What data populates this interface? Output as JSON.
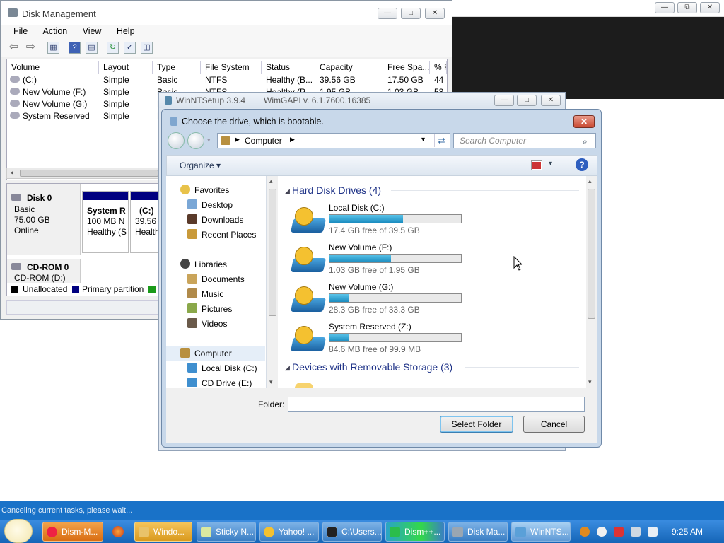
{
  "background_window": {
    "buttons": [
      "—",
      "⧉",
      "✕"
    ]
  },
  "disk_management": {
    "title": "Disk Management",
    "menu": [
      "File",
      "Action",
      "View",
      "Help"
    ],
    "columns": [
      "Volume",
      "Layout",
      "Type",
      "File System",
      "Status",
      "Capacity",
      "Free Spa...",
      "% F"
    ],
    "rows": [
      {
        "volume": "(C:)",
        "layout": "Simple",
        "type": "Basic",
        "fs": "NTFS",
        "status": "Healthy (B...",
        "capacity": "39.56 GB",
        "free": "17.50 GB",
        "pct": "44"
      },
      {
        "volume": "New Volume (F:)",
        "layout": "Simple",
        "type": "Basic",
        "fs": "NTFS",
        "status": "Healthy (P...",
        "capacity": "1.95 GB",
        "free": "1.03 GB",
        "pct": "53"
      },
      {
        "volume": "New Volume (G:)",
        "layout": "Simple",
        "type": "B",
        "fs": "",
        "status": "",
        "capacity": "",
        "free": "",
        "pct": ""
      },
      {
        "volume": "System Reserved",
        "layout": "Simple",
        "type": "B",
        "fs": "",
        "status": "",
        "capacity": "",
        "free": "",
        "pct": ""
      }
    ],
    "disk0": {
      "name": "Disk 0",
      "type": "Basic",
      "size": "75.00 GB",
      "state": "Online"
    },
    "partitions": [
      {
        "name": "System R",
        "size": "100 MB N",
        "status": "Healthy (S"
      },
      {
        "name": "(C:)",
        "size": "39.56 G",
        "status": "Health"
      }
    ],
    "cdrom": {
      "name": "CD-ROM 0",
      "label": "CD-ROM (D:)"
    },
    "legend": [
      {
        "label": "Unallocated",
        "color": "#000000"
      },
      {
        "label": "Primary partition",
        "color": "#000080"
      }
    ]
  },
  "winntsetup": {
    "title": "WinNTSetup 3.9.4",
    "wimgapi": "WimGAPI v. 6.1.7600.16385"
  },
  "dialog": {
    "title": "Choose the drive, which is bootable.",
    "address": "Computer",
    "search_placeholder": "Search Computer",
    "organize": "Organize",
    "nav": {
      "favorites_label": "Favorites",
      "favorites": [
        "Desktop",
        "Downloads",
        "Recent Places"
      ],
      "libraries_label": "Libraries",
      "libraries": [
        "Documents",
        "Music",
        "Pictures",
        "Videos"
      ],
      "computer_label": "Computer",
      "computer": [
        "Local Disk (C:)",
        "CD Drive (E:)"
      ]
    },
    "group_hdd": "Hard Disk Drives (4)",
    "drives": [
      {
        "name": "Local Disk (C:)",
        "free": "17.4 GB free of 39.5 GB",
        "used": 0.56
      },
      {
        "name": "New Volume (F:)",
        "free": "1.03 GB free of 1.95 GB",
        "used": 0.47
      },
      {
        "name": "New Volume (G:)",
        "free": "28.3 GB free of 33.3 GB",
        "used": 0.15
      },
      {
        "name": "System Reserved (Z:)",
        "free": "84.6 MB free of 99.9 MB",
        "used": 0.15
      }
    ],
    "group_removable": "Devices with Removable Storage (3)",
    "folder_label": "Folder:",
    "folder_value": "",
    "select_button": "Select Folder",
    "cancel_button": "Cancel"
  },
  "statusbar": "Canceling current tasks, please wait...",
  "taskbar": {
    "tasks": [
      "Dism-M...",
      "Windo...",
      "Sticky N...",
      "Yahoo! ...",
      "C:\\Users...",
      "Dism++...",
      "Disk Ma...",
      "WinNTS..."
    ],
    "clock": "9:25 AM"
  },
  "colors": {
    "accent": "#1972c8",
    "group_header": "#1e3287",
    "bar_fill": "#1b8dc0",
    "primary_partition": "#000080"
  }
}
